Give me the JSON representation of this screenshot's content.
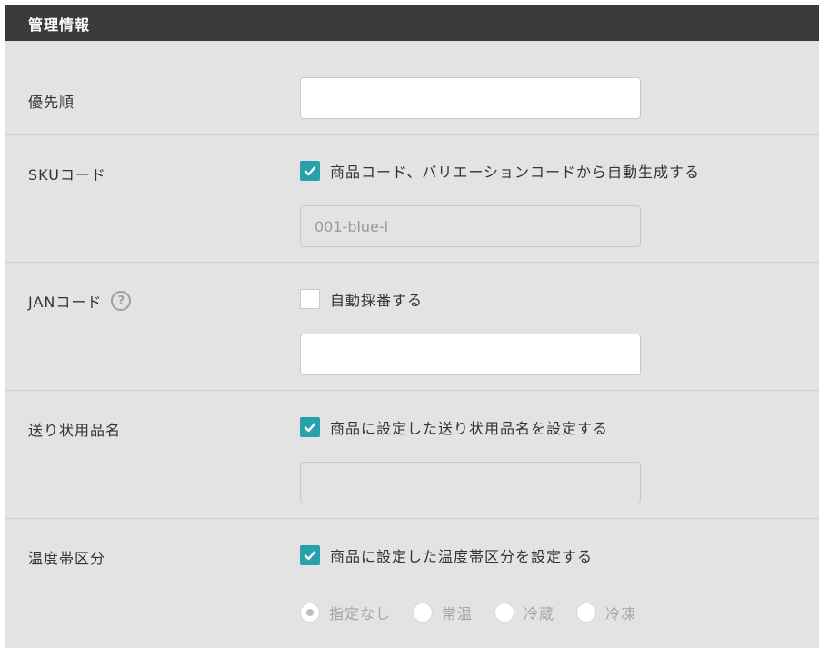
{
  "section": {
    "title": "管理情報"
  },
  "priority": {
    "label": "優先順",
    "value": ""
  },
  "sku": {
    "label": "SKUコード",
    "checkbox_label": "商品コード、バリエーションコードから自動生成する",
    "checkbox_checked": true,
    "input_placeholder": "001-blue-l"
  },
  "jan": {
    "label": "JANコード",
    "help_icon": "question-circle-icon",
    "help_glyph": "?",
    "checkbox_label": "自動採番する",
    "checkbox_checked": false,
    "value": ""
  },
  "shipping_name": {
    "label": "送り状用品名",
    "checkbox_label": "商品に設定した送り状用品名を設定する",
    "checkbox_checked": true,
    "value": ""
  },
  "temperature": {
    "label": "温度帯区分",
    "checkbox_label": "商品に設定した温度帯区分を設定する",
    "checkbox_checked": true,
    "options": [
      {
        "label": "指定なし",
        "selected": true
      },
      {
        "label": "常温",
        "selected": false
      },
      {
        "label": "冷蔵",
        "selected": false
      },
      {
        "label": "冷凍",
        "selected": false
      }
    ]
  },
  "colors": {
    "header_bg": "#3b3b3b",
    "panel_bg": "#e3e3e3",
    "accent": "#27a2ab"
  }
}
